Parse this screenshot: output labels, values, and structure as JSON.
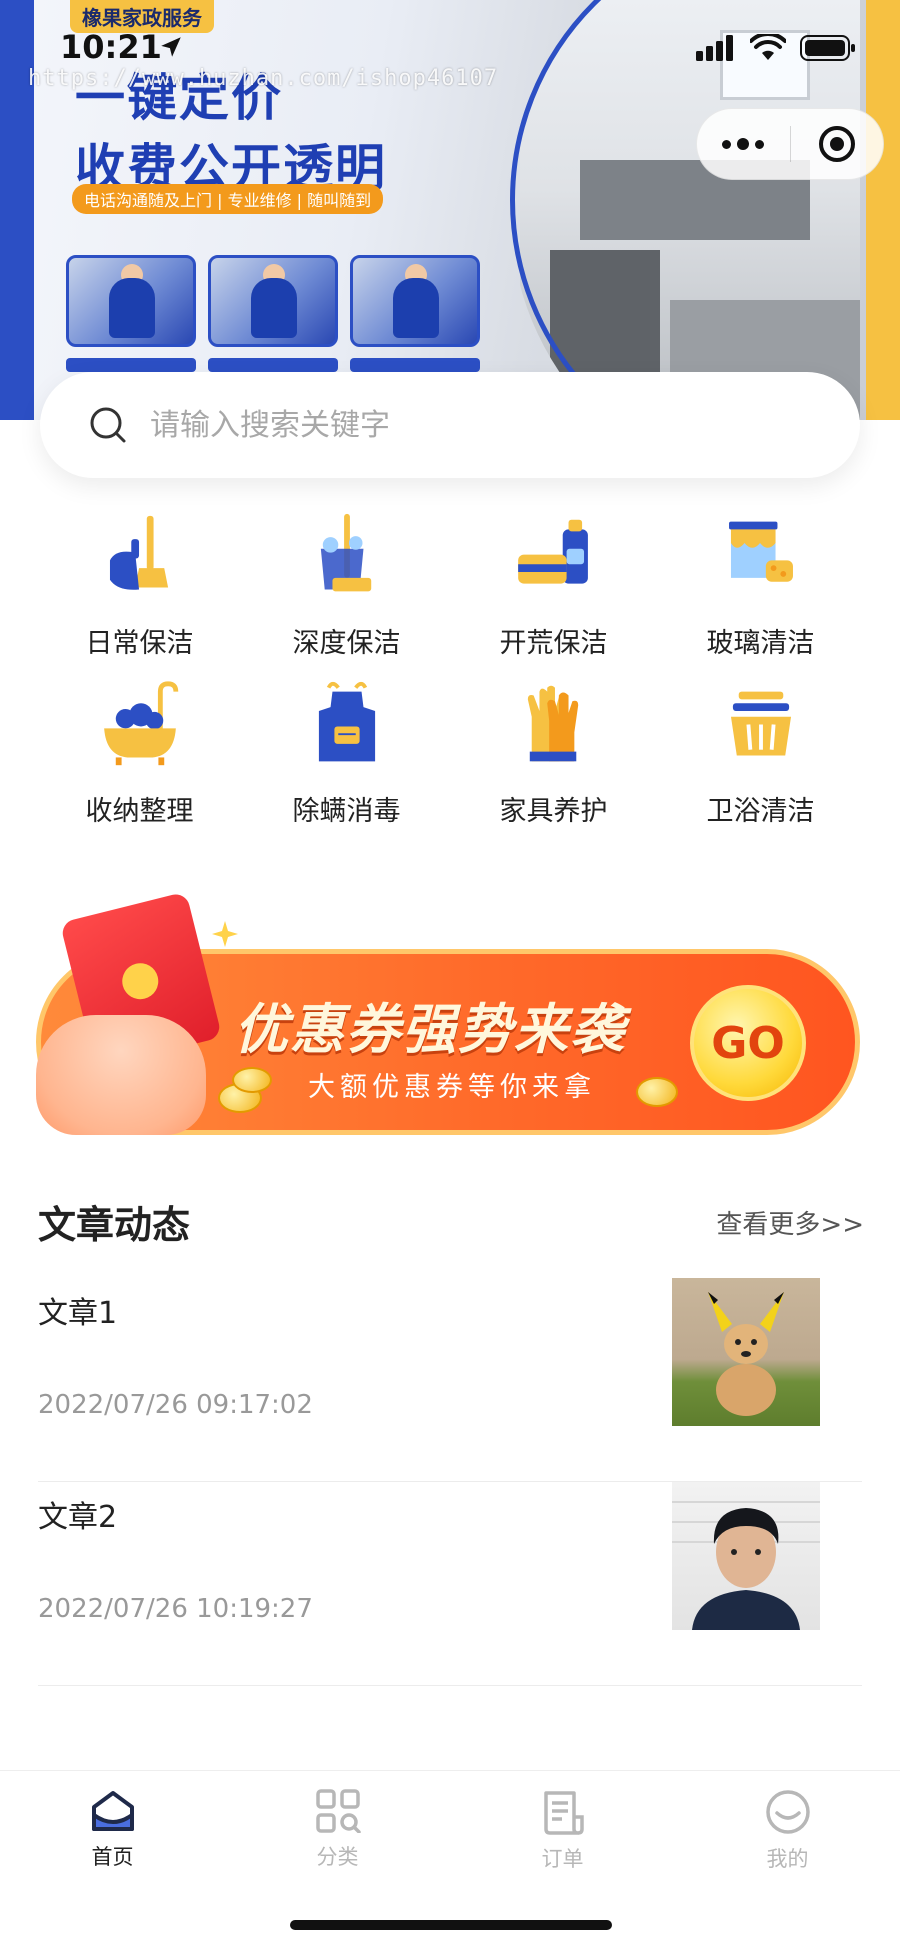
{
  "status_bar": {
    "time": "10:21"
  },
  "banner": {
    "brand_tag": "橡果家政服务",
    "headline_line1": "一键定价",
    "headline_line2": "收费公开透明",
    "subline": "电话沟通随及上门 | 专业维修 | 随叫随到",
    "watermark": "https://www.huzhan.com/ishop46107"
  },
  "search": {
    "placeholder": "请输入搜索关键字",
    "value": ""
  },
  "categories": [
    {
      "label": "日常保洁",
      "icon": "broom-dustpan-icon"
    },
    {
      "label": "深度保洁",
      "icon": "mop-bucket-icon"
    },
    {
      "label": "开荒保洁",
      "icon": "cleaning-supplies-icon"
    },
    {
      "label": "玻璃清洁",
      "icon": "paint-sponge-icon"
    },
    {
      "label": "收纳整理",
      "icon": "bathtub-icon"
    },
    {
      "label": "除螨消毒",
      "icon": "apron-icon"
    },
    {
      "label": "家具养护",
      "icon": "gloves-icon"
    },
    {
      "label": "卫浴清洁",
      "icon": "basket-icon"
    }
  ],
  "coupon": {
    "title": "优惠券强势来袭",
    "subtitle": "大额优惠券等你来拿",
    "button": "GO"
  },
  "articles_section": {
    "title": "文章动态",
    "more": "查看更多>>",
    "items": [
      {
        "title": "文章1",
        "date": "2022/07/26 09:17:02"
      },
      {
        "title": "文章2",
        "date": "2022/07/26 10:19:27"
      }
    ]
  },
  "tabbar": {
    "items": [
      {
        "label": "首页",
        "icon": "home-icon",
        "active": true
      },
      {
        "label": "分类",
        "icon": "category-grid-icon",
        "active": false
      },
      {
        "label": "订单",
        "icon": "order-list-icon",
        "active": false
      },
      {
        "label": "我的",
        "icon": "profile-face-icon",
        "active": false
      }
    ]
  },
  "colors": {
    "brand_blue": "#2c4fc4",
    "accent_yellow": "#f6c142",
    "coupon_orange": "#ff6a2a",
    "tab_inactive": "#b7b7b7"
  }
}
